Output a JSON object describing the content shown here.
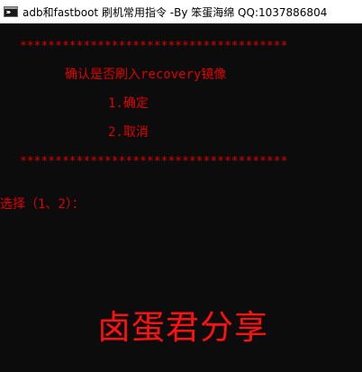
{
  "window": {
    "title": "adb和fastboot 刷机常用指令   -By 笨蛋海绵 QQ:1037886804",
    "icon": "cmd-console-icon"
  },
  "console": {
    "border_top": "**************************************",
    "question": "确认是否刷入recovery镜像",
    "option_1": "1.确定",
    "option_2": "2.取消",
    "border_bottom": "**************************************",
    "prompt": "选择（1、2）："
  },
  "watermark": "卤蛋君分享",
  "colors": {
    "background": "#0c0c0c",
    "console_text": "#e00000",
    "watermark": "#ff1010",
    "titlebar": "#ffffff"
  }
}
